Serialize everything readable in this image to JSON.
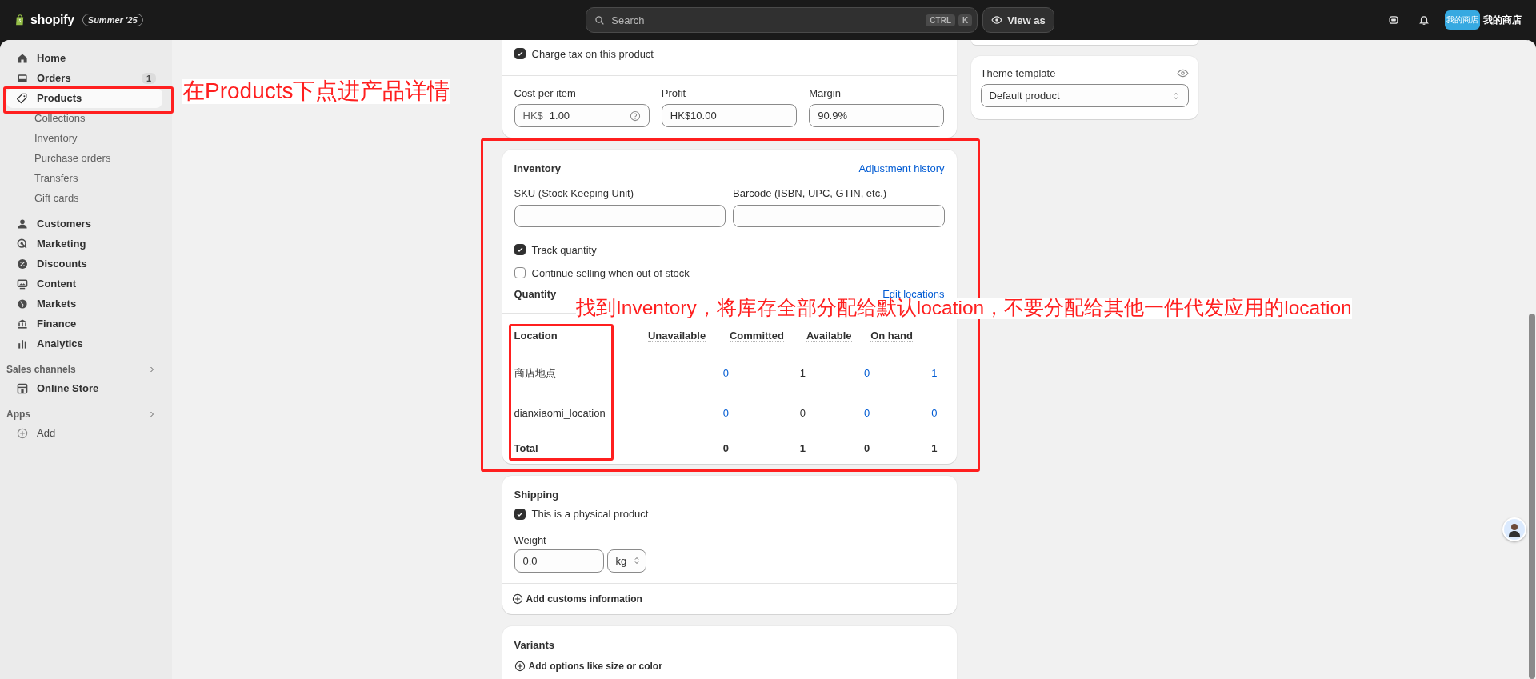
{
  "topbar": {
    "logo": "shopify",
    "edition_badge": "Summer '25",
    "search": {
      "placeholder": "Search",
      "shortcut": [
        "CTRL",
        "K"
      ]
    },
    "view_as": "View as",
    "store": {
      "avatar_text": "我的商店",
      "name": "我的商店"
    }
  },
  "sidebar": {
    "items": [
      {
        "label": "Home",
        "kind": "main",
        "selected": false
      },
      {
        "label": "Orders",
        "kind": "main",
        "selected": false,
        "badge": "1"
      },
      {
        "label": "Products",
        "kind": "main",
        "selected": true
      },
      {
        "label": "Collections",
        "kind": "sub",
        "selected": false
      },
      {
        "label": "Inventory",
        "kind": "sub",
        "selected": false
      },
      {
        "label": "Purchase orders",
        "kind": "sub",
        "selected": false
      },
      {
        "label": "Transfers",
        "kind": "sub",
        "selected": false
      },
      {
        "label": "Gift cards",
        "kind": "sub",
        "selected": false
      },
      {
        "label": "Customers",
        "kind": "main",
        "selected": false
      },
      {
        "label": "Marketing",
        "kind": "main",
        "selected": false
      },
      {
        "label": "Discounts",
        "kind": "main",
        "selected": false
      },
      {
        "label": "Content",
        "kind": "main",
        "selected": false
      },
      {
        "label": "Markets",
        "kind": "main",
        "selected": false
      },
      {
        "label": "Finance",
        "kind": "main",
        "selected": false
      },
      {
        "label": "Analytics",
        "kind": "main",
        "selected": false
      }
    ],
    "sections": [
      {
        "title": "Sales channels",
        "items": [
          {
            "label": "Online Store"
          }
        ]
      },
      {
        "title": "Apps",
        "items": [
          {
            "label": "Add"
          }
        ]
      }
    ]
  },
  "pricing_card": {
    "checkbox": {
      "label": "Charge tax on this product",
      "checked": true
    },
    "fields": [
      {
        "label": "Cost per item",
        "prefix": "HK$",
        "value": "1.00",
        "help": true
      },
      {
        "label": "Profit",
        "value": "HK$10.00",
        "help": false
      },
      {
        "label": "Margin",
        "value": "90.9%",
        "help": false
      }
    ]
  },
  "inventory_card": {
    "title": "Inventory",
    "link": "Adjustment history",
    "fields": [
      {
        "label": "SKU (Stock Keeping Unit)"
      },
      {
        "label": "Barcode (ISBN, UPC, GTIN, etc.)"
      }
    ],
    "checkboxes": [
      {
        "label": "Track quantity",
        "checked": true
      },
      {
        "label": "Continue selling when out of stock",
        "checked": false
      }
    ],
    "quantity_label": "Quantity",
    "quantity_link": "Edit locations",
    "table": {
      "columns": [
        {
          "label": "Location",
          "link": false
        },
        {
          "label": "Unavailable",
          "link": true
        },
        {
          "label": "Committed",
          "link": false
        },
        {
          "label": "Available",
          "link": true
        },
        {
          "label": "On hand",
          "link": true
        }
      ],
      "rows": [
        [
          "商店地点",
          "0",
          "1",
          "0",
          "1"
        ],
        [
          "dianxiaomi_location",
          "0",
          "0",
          "0",
          "0"
        ]
      ],
      "total": [
        "Total",
        "0",
        "1",
        "0",
        "1"
      ]
    }
  },
  "shipping_card": {
    "title": "Shipping",
    "checkbox": {
      "label": "This is a physical product",
      "checked": true
    },
    "weight_label": "Weight",
    "weight_value": "0.0",
    "unit": "kg",
    "customs_link": "Add customs information"
  },
  "variants_card": {
    "title": "Variants",
    "add_link": "Add options like size or color"
  },
  "theme_card": {
    "label": "Theme template",
    "value": "Default product"
  },
  "annotations": [
    {
      "kind": "box"
    },
    {
      "kind": "note",
      "text": "在Products下点进产品详情"
    },
    {
      "kind": "box"
    },
    {
      "kind": "note",
      "text": "找到Inventory，将库存全部分配给默认location，不要分配给其他一件代发应用的location"
    },
    {
      "kind": "box"
    }
  ]
}
